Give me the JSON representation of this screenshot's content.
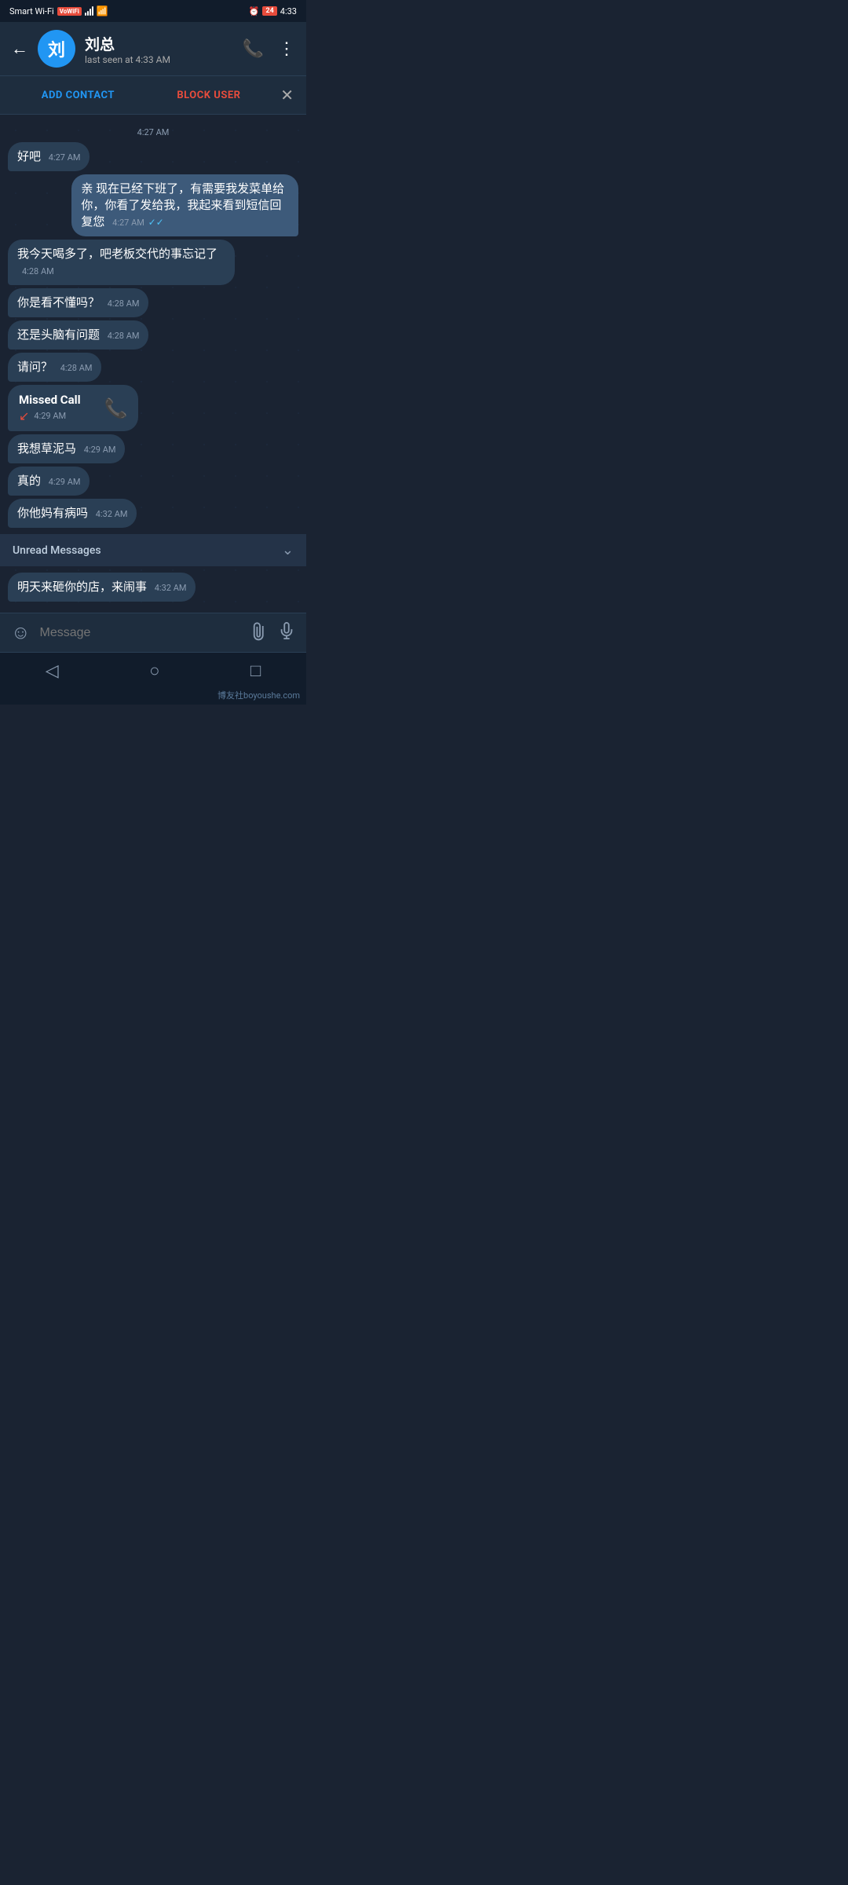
{
  "statusBar": {
    "carrier": "Smart Wi-Fi",
    "vowifi": "VoWiFi",
    "time": "4:33",
    "batteryNum": "24"
  },
  "header": {
    "avatarLetter": "刘",
    "contactName": "刘总",
    "lastSeen": "last seen at 4:33 AM",
    "backLabel": "←"
  },
  "actionBar": {
    "addContact": "ADD CONTACT",
    "blockUser": "BLOCK USER",
    "close": "✕"
  },
  "messages": [
    {
      "id": 1,
      "type": "timestamp-center",
      "text": "4:27 AM"
    },
    {
      "id": 2,
      "type": "incoming",
      "text": "好吧",
      "time": "4:27 AM"
    },
    {
      "id": 3,
      "type": "outgoing",
      "text": "亲 现在已经下班了，有需要我发菜单给你，你看了发给我，我起来看到短信回复您",
      "time": "4:27 AM",
      "ticks": "✓✓"
    },
    {
      "id": 4,
      "type": "incoming",
      "text": "我今天喝多了，吧老板交代的事忘记了",
      "time": "4:28 AM"
    },
    {
      "id": 5,
      "type": "incoming",
      "text": "你是看不懂吗？",
      "time": "4:28 AM"
    },
    {
      "id": 6,
      "type": "incoming",
      "text": "还是头脑有问题",
      "time": "4:28 AM"
    },
    {
      "id": 7,
      "type": "incoming",
      "text": "请问？",
      "time": "4:28 AM"
    },
    {
      "id": 8,
      "type": "missed-call",
      "label": "Missed Call",
      "arrow": "↙",
      "time": "4:29 AM"
    },
    {
      "id": 9,
      "type": "incoming",
      "text": "我想草泥马",
      "time": "4:29 AM"
    },
    {
      "id": 10,
      "type": "incoming",
      "text": "真的",
      "time": "4:29 AM"
    },
    {
      "id": 11,
      "type": "incoming",
      "text": "你他妈有病吗",
      "time": "4:32 AM"
    }
  ],
  "unreadDivider": {
    "label": "Unread Messages",
    "chevron": "⌄"
  },
  "unreadMessages": [
    {
      "id": 12,
      "type": "incoming",
      "text": "明天来砸你的店，来闹事",
      "time": "4:32 AM"
    }
  ],
  "inputBar": {
    "placeholder": "Message",
    "emojiIcon": "☺",
    "attachIcon": "⊘",
    "micIcon": "⊕"
  },
  "navBar": {
    "back": "◁",
    "home": "○",
    "recent": "□"
  },
  "watermark": "博友社boyoushe.com"
}
